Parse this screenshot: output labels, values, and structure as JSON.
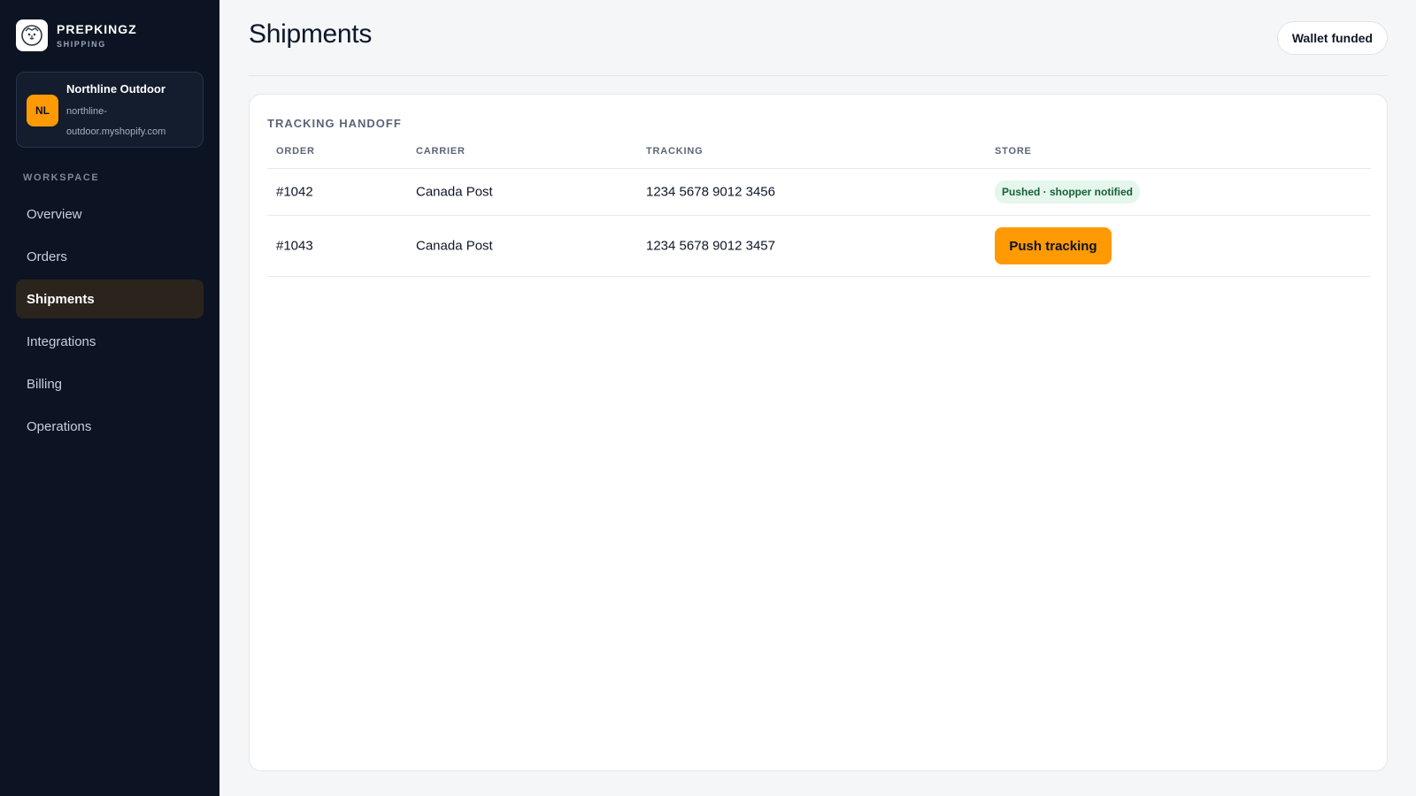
{
  "brand": {
    "name": "PREPKINGZ",
    "subtitle": "SHIPPING",
    "logo_icon": "lion-icon"
  },
  "store": {
    "initials": "NL",
    "name": "Northline Outdoor",
    "domain": "northline-outdoor.myshopify.com"
  },
  "sidebar": {
    "section_label": "WORKSPACE",
    "items": [
      {
        "label": "Overview",
        "active": false
      },
      {
        "label": "Orders",
        "active": false
      },
      {
        "label": "Shipments",
        "active": true
      },
      {
        "label": "Integrations",
        "active": false
      },
      {
        "label": "Billing",
        "active": false
      },
      {
        "label": "Operations",
        "active": false
      }
    ]
  },
  "header": {
    "title": "Shipments",
    "wallet_status": "Wallet funded"
  },
  "card": {
    "label": "TRACKING HANDOFF",
    "columns": [
      "ORDER",
      "CARRIER",
      "TRACKING",
      "STORE"
    ],
    "rows": [
      {
        "order": "#1042",
        "carrier": "Canada Post",
        "tracking": "1234 5678 9012 3456",
        "store_status": "Pushed · shopper notified"
      },
      {
        "order": "#1043",
        "carrier": "Canada Post",
        "tracking": "1234 5678 9012 3457",
        "store_action": "Push tracking"
      }
    ]
  },
  "colors": {
    "sidebar_bg": "#0c1322",
    "accent": "#ff9a05",
    "active_nav_bg": "#2a241d",
    "success_bg": "#e5f6ec",
    "success_text": "#166038"
  }
}
